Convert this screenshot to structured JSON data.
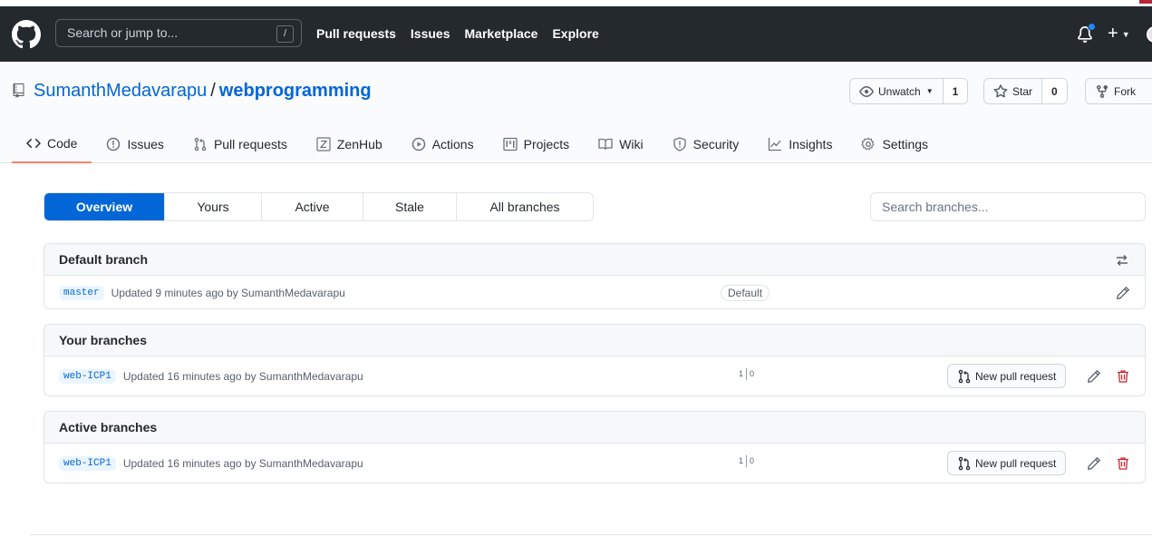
{
  "header": {
    "search_placeholder": "Search or jump to...",
    "search_key": "/",
    "nav": [
      "Pull requests",
      "Issues",
      "Marketplace",
      "Explore"
    ]
  },
  "repo": {
    "owner": "SumanthMedavarapu",
    "separator": "/",
    "name": "webprogramming",
    "watch_label": "Unwatch",
    "watch_count": "1",
    "star_label": "Star",
    "star_count": "0",
    "fork_label": "Fork"
  },
  "tabs": [
    {
      "label": "Code",
      "icon": "code-icon"
    },
    {
      "label": "Issues",
      "icon": "issue-icon"
    },
    {
      "label": "Pull requests",
      "icon": "pull-request-icon"
    },
    {
      "label": "ZenHub",
      "icon": "zenhub-icon"
    },
    {
      "label": "Actions",
      "icon": "play-icon"
    },
    {
      "label": "Projects",
      "icon": "project-icon"
    },
    {
      "label": "Wiki",
      "icon": "book-icon"
    },
    {
      "label": "Security",
      "icon": "shield-icon"
    },
    {
      "label": "Insights",
      "icon": "graph-icon"
    },
    {
      "label": "Settings",
      "icon": "gear-icon"
    }
  ],
  "branch_nav": [
    "Overview",
    "Yours",
    "Active",
    "Stale",
    "All branches"
  ],
  "branch_search_placeholder": "Search branches...",
  "sections": {
    "default": {
      "title": "Default branch",
      "branch": "master",
      "updated": "Updated 9 minutes ago by",
      "user": "SumanthMedavarapu",
      "badge": "Default"
    },
    "yours": {
      "title": "Your branches",
      "branch": "web-ICP1",
      "updated": "Updated 16 minutes ago by",
      "user": "SumanthMedavarapu",
      "behind": "1",
      "ahead": "0",
      "pr_label": "New pull request"
    },
    "active": {
      "title": "Active branches",
      "branch": "web-ICP1",
      "updated": "Updated 16 minutes ago by",
      "user": "SumanthMedavarapu",
      "behind": "1",
      "ahead": "0",
      "pr_label": "New pull request"
    }
  },
  "colors": {
    "header_bg": "#24292e",
    "accent": "#0366d6",
    "tab_underline": "#f9826c",
    "danger": "#cb2431"
  }
}
